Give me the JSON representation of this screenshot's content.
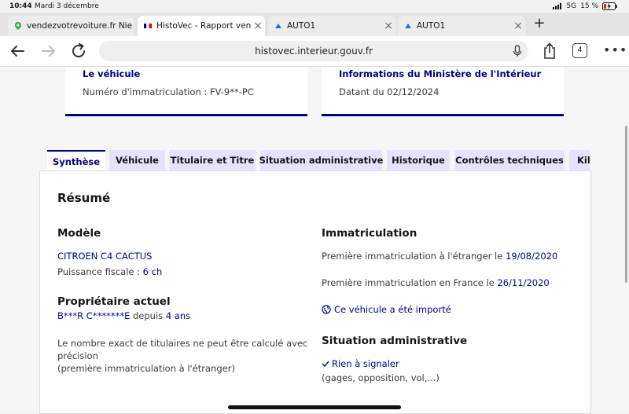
{
  "status_bar": {
    "time": "10:44",
    "date": "Mardi 3 décembre",
    "network": "5G",
    "battery": "15 %"
  },
  "browser_tabs": [
    {
      "title": "vendezvotrevoiture.fr Nie",
      "icon": "maps-pin-icon",
      "active": false
    },
    {
      "title": "HistoVec - Rapport vende",
      "icon": "french-flag-icon",
      "active": true
    },
    {
      "title": "AUTO1",
      "icon": "auto1-logo-icon",
      "active": false
    },
    {
      "title": "AUTO1",
      "icon": "auto1-logo-icon",
      "active": false
    }
  ],
  "toolbar": {
    "url": "histovec.interieur.gouv.fr",
    "tab_count": "4"
  },
  "cards": {
    "vehicle": {
      "title": "Le véhicule",
      "text": "Numéro d'immatriculation : FV-9**-PC"
    },
    "ministry": {
      "title": "Informations du Ministère de l'Intérieur",
      "text": "Datant du 02/12/2024"
    }
  },
  "page_tabs": [
    "Synthèse",
    "Véhicule",
    "Titulaire et Titre",
    "Situation administrative",
    "Historique",
    "Contrôles techniques",
    "Kilo"
  ],
  "summary": {
    "heading": "Résumé",
    "model": {
      "heading": "Modèle",
      "name": "CITROEN C4 CACTUS",
      "power_label": "Puissance fiscale : ",
      "power_value": "6 ch"
    },
    "owner": {
      "heading": "Propriétaire actuel",
      "name": "B***R C*******E",
      "since_label": " depuis ",
      "since_value": "4 ans",
      "note_line1": "Le nombre exact de titulaires ne peut être calculé avec",
      "note_line2": "précision",
      "note_line3": "(première immatriculation à l'étranger)"
    },
    "registration": {
      "heading": "Immatriculation",
      "foreign_label": "Première immatriculation à l'étranger le ",
      "foreign_date": "19/08/2020",
      "france_label": "Première immatriculation en France le ",
      "france_date": "26/11/2020",
      "imported_link": "Ce véhicule a été importé"
    },
    "admin": {
      "heading": "Situation administrative",
      "status": "Rien à signaler",
      "details": "(gages, opposition, vol,...)"
    }
  },
  "colors": {
    "accent": "#000091",
    "tab_bg": "#e3e3fd"
  }
}
